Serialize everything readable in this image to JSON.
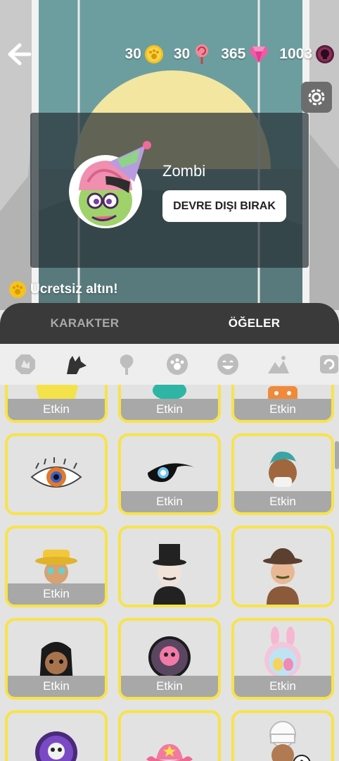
{
  "header": {
    "stats": [
      {
        "value": "30",
        "icon": "gold-paw-coin-icon"
      },
      {
        "value": "30",
        "icon": "lollipop-icon"
      },
      {
        "value": "365",
        "icon": "pink-gem-icon"
      },
      {
        "value": "1003",
        "icon": "skull-token-icon"
      }
    ]
  },
  "character": {
    "name": "Zombi",
    "action_label": "DEVRE DIŞI BIRAK"
  },
  "promo": {
    "free_gold": "Ücretsiz altın!"
  },
  "tabs": [
    {
      "label": "KARAKTER",
      "active": false
    },
    {
      "label": "ÖĞELER",
      "active": true
    }
  ],
  "categories": [
    "badge-icon",
    "wolf-icon",
    "rose-icon",
    "paw-icon",
    "smiley-icon",
    "landscape-icon",
    "refresh-icon"
  ],
  "items": [
    {
      "art": "yellow-item",
      "status": "Etkin"
    },
    {
      "art": "teal-item",
      "status": "Etkin"
    },
    {
      "art": "orange-item",
      "status": "Etkin"
    },
    {
      "art": "eye-makeup",
      "status": ""
    },
    {
      "art": "tear-eye",
      "status": "Etkin"
    },
    {
      "art": "doctor-avatar",
      "status": "Etkin"
    },
    {
      "art": "yellow-hat-avatar",
      "status": "Etkin"
    },
    {
      "art": "top-hat-avatar",
      "status": ""
    },
    {
      "art": "fedora-avatar",
      "status": ""
    },
    {
      "art": "girl-avatar",
      "status": "Etkin"
    },
    {
      "art": "skull-globe",
      "status": "Etkin"
    },
    {
      "art": "easter-globe",
      "status": "Etkin"
    },
    {
      "art": "purple-skull",
      "status": ""
    },
    {
      "art": "cowboy-hat",
      "status": ""
    },
    {
      "art": "chef-avatar",
      "status": ""
    }
  ],
  "colors": {
    "tab_bg": "#3a3a3a",
    "cell_border": "#f7e34a",
    "active_bg": "#a8a8a8"
  }
}
